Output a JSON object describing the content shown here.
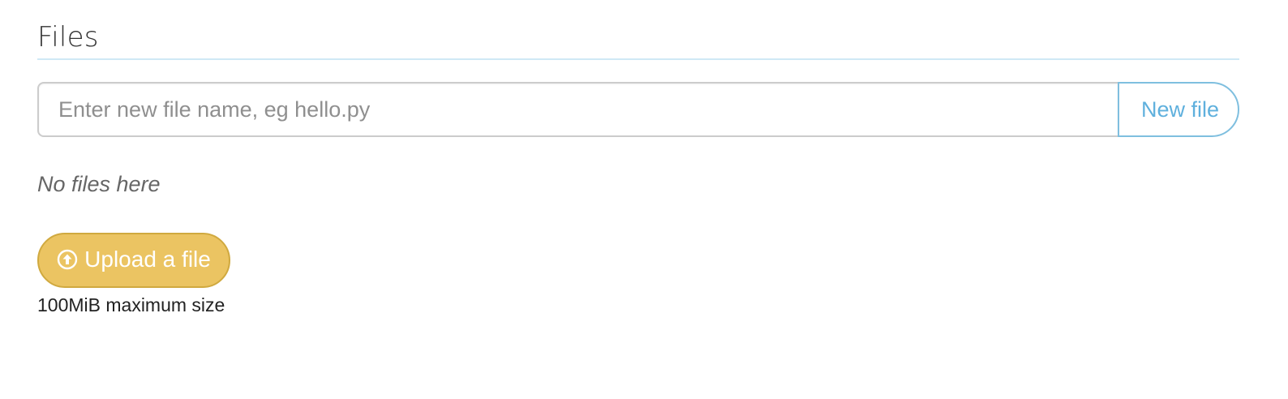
{
  "files_section": {
    "title": "Files",
    "new_file_form": {
      "input_placeholder": "Enter new file name, eg hello.py",
      "input_value": "",
      "button_label": "New file"
    },
    "empty_message": "No files here",
    "upload": {
      "button_label": "Upload a file",
      "icon": "circle-arrow-up-icon",
      "size_note": "100MiB maximum size"
    }
  },
  "colors": {
    "new_file_accent": "#5fb0dd",
    "upload_button_bg": "#ebc462",
    "title_rule": "#cfe9f5"
  }
}
